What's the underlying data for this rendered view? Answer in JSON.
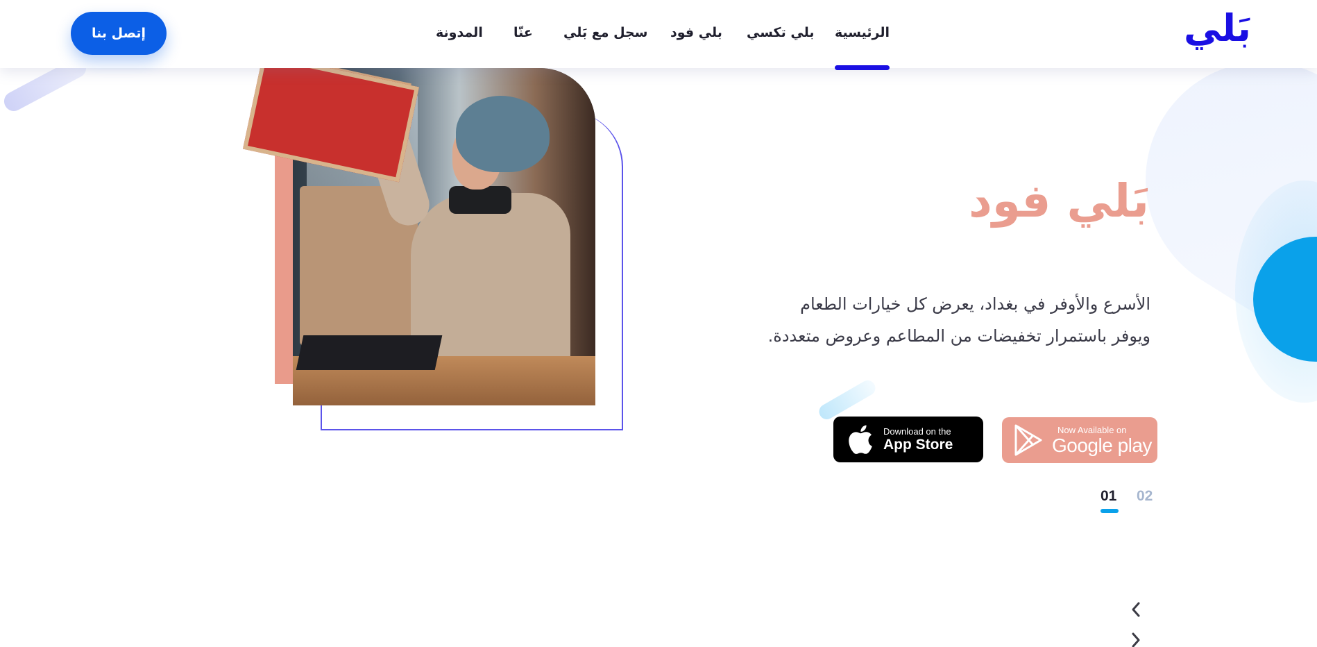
{
  "header": {
    "logo_text": "بَلي",
    "nav": [
      {
        "label": "الرئيسية",
        "active": true
      },
      {
        "label": "بلي تكسي",
        "active": false
      },
      {
        "label": "بلي فود",
        "active": false
      },
      {
        "label": "سجل مع بَلي",
        "active": false
      },
      {
        "label": "عنّا",
        "active": false
      },
      {
        "label": "المدونة",
        "active": false
      }
    ],
    "contact_label": "إتصل بنا"
  },
  "hero": {
    "title": "بَلي فود",
    "description_line1": "الأسرع والأوفر في بغداد، يعرض كل خيارات الطعام",
    "description_line2": "ويوفر باستمرار تخفيضات من المطاعم وعروض متعددة.",
    "image_icon": "food-delivery-photo"
  },
  "stores": {
    "apple": {
      "small": "Download on the",
      "big": "App Store",
      "icon": "apple-icon"
    },
    "google": {
      "small": "Now Available on",
      "big": "Google play",
      "icon": "play-icon"
    }
  },
  "pager": {
    "current": "01",
    "next": "02"
  },
  "colors": {
    "brand_blue": "#1a0fe3",
    "button_blue": "#0c5fe6",
    "salmon": "#ea9d8f",
    "cyan": "#0aa1ea",
    "outline": "#5b53ea"
  }
}
